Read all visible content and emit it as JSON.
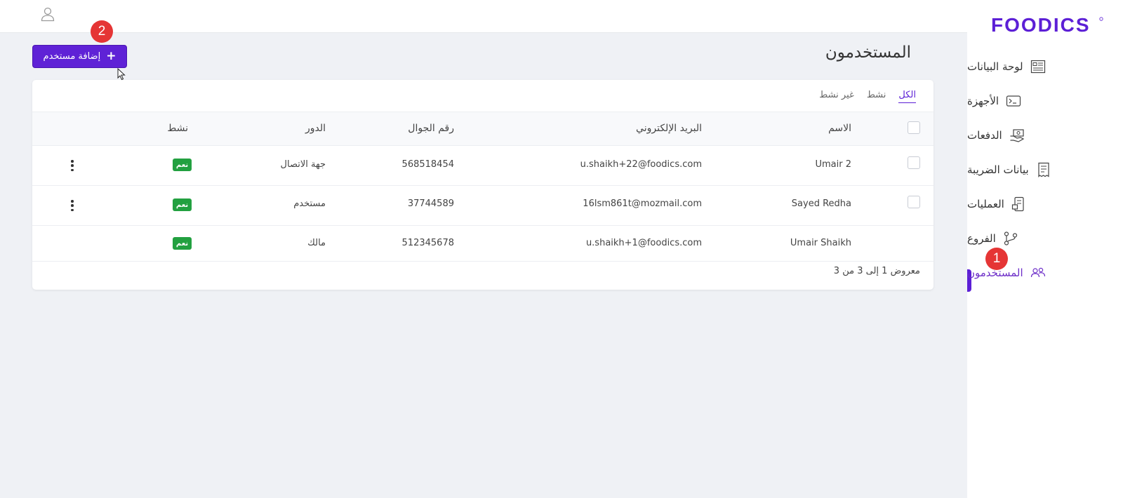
{
  "brand": {
    "logo_text": "FOODICS",
    "accent": "#5c1fd6"
  },
  "sidebar": {
    "items": [
      {
        "label": "لوحة البيانات",
        "icon": "dashboard-icon"
      },
      {
        "label": "الأجهزة",
        "icon": "terminal-icon"
      },
      {
        "label": "الدفعات",
        "icon": "payments-icon"
      },
      {
        "label": "بيانات الضريبة",
        "icon": "receipt-icon"
      },
      {
        "label": "العمليات",
        "icon": "operations-icon"
      },
      {
        "label": "الفروع",
        "icon": "branches-icon"
      },
      {
        "label": "المستخدمون",
        "icon": "users-icon",
        "active": true
      }
    ]
  },
  "annotations": {
    "badge_1": "1",
    "badge_2": "2"
  },
  "page": {
    "title": "المستخدمون"
  },
  "toolbar": {
    "add_user_label": "إضافة مستخدم"
  },
  "filters": {
    "all": "الكل",
    "active": "نشط",
    "inactive": "غير نشط"
  },
  "table": {
    "headers": {
      "name": "الاسم",
      "email": "البريد الإلكتروني",
      "phone": "رقم الجوال",
      "role": "الدور",
      "active": "نشط"
    },
    "rows": [
      {
        "name": "Umair 2",
        "email": "u.shaikh+22@foodics.com",
        "phone": "568518454",
        "role": "جهة الاتصال",
        "active": "نعم"
      },
      {
        "name": "Sayed Redha",
        "email": "16lsm861t@mozmail.com",
        "phone": "37744589",
        "role": "مستخدم",
        "active": "نعم"
      },
      {
        "name": "Umair Shaikh",
        "email": "u.shaikh+1@foodics.com",
        "phone": "512345678",
        "role": "مالك",
        "active": "نعم"
      }
    ],
    "footer": "معروض 1 إلى 3 من 3"
  }
}
